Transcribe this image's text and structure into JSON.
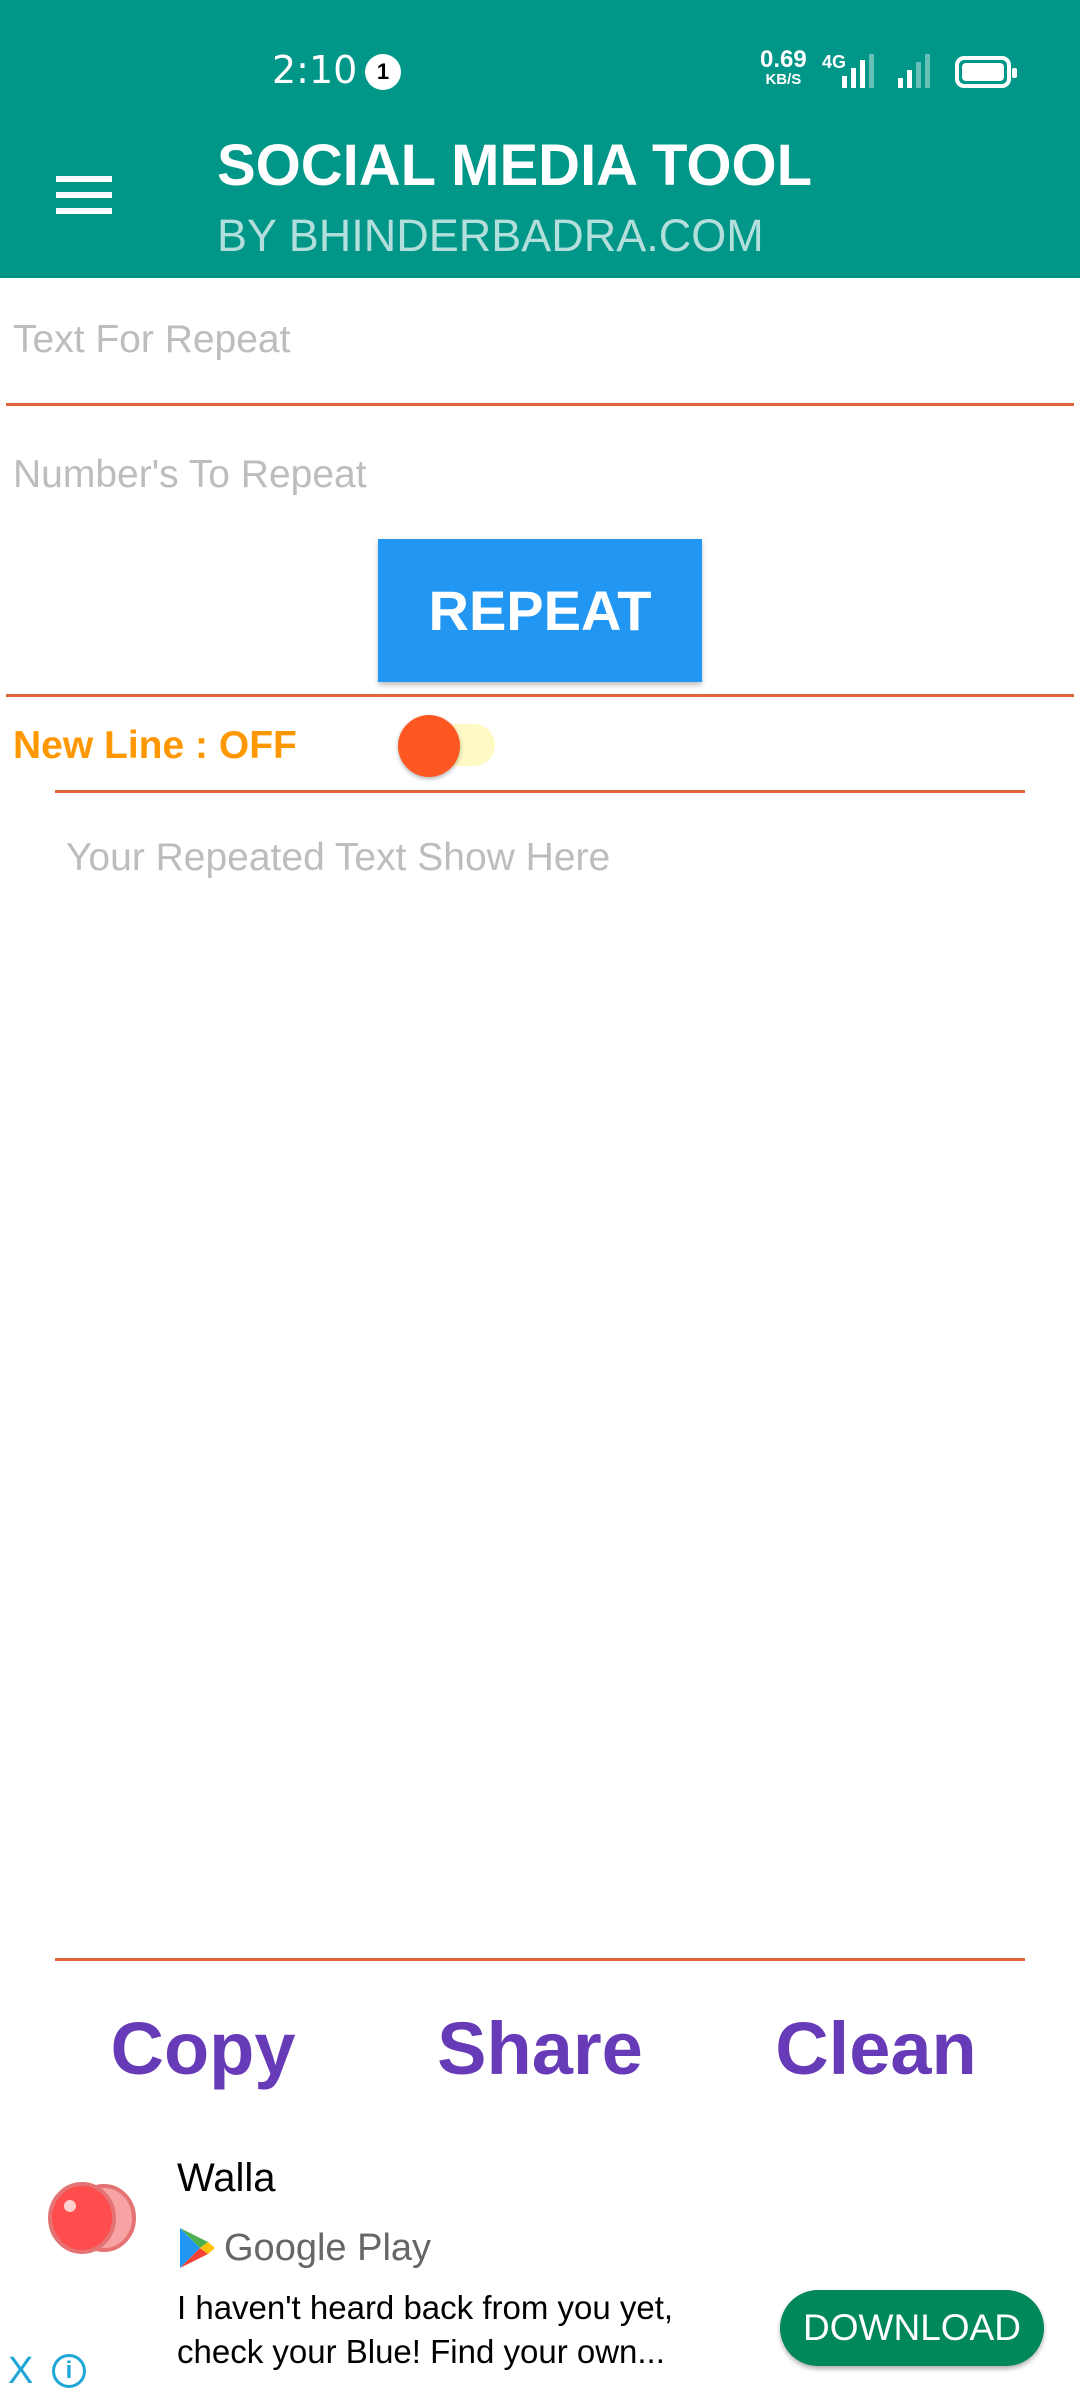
{
  "status_bar": {
    "time": "2:10",
    "notification_count": "1",
    "speed_value": "0.69",
    "speed_unit": "KB/S",
    "network": "4G"
  },
  "header": {
    "title": "SOCIAL MEDIA TOOL",
    "subtitle": "BY BHINDERBADRA.COM",
    "menu_icon": "hamburger-icon"
  },
  "form": {
    "text_placeholder": "Text For Repeat",
    "number_placeholder": "Number's To Repeat",
    "repeat_label": "REPEAT",
    "newline_label": "New Line : OFF",
    "newline_on": false,
    "output_placeholder": "Your Repeated Text Show Here"
  },
  "actions": {
    "copy": "Copy",
    "share": "Share",
    "clean": "Clean"
  },
  "ad": {
    "title": "Walla",
    "store": "Google Play",
    "description": "I haven't heard back from you yet, check your Blue! Find your own...",
    "cta": "DOWNLOAD",
    "close": "X"
  },
  "colors": {
    "header": "#009688",
    "button": "#2196F3",
    "accent_line": "#e0653a",
    "toggle_label": "#FF9800",
    "toggle_thumb": "#FF5722",
    "actions": "#673AB7",
    "cta": "#00875A"
  }
}
